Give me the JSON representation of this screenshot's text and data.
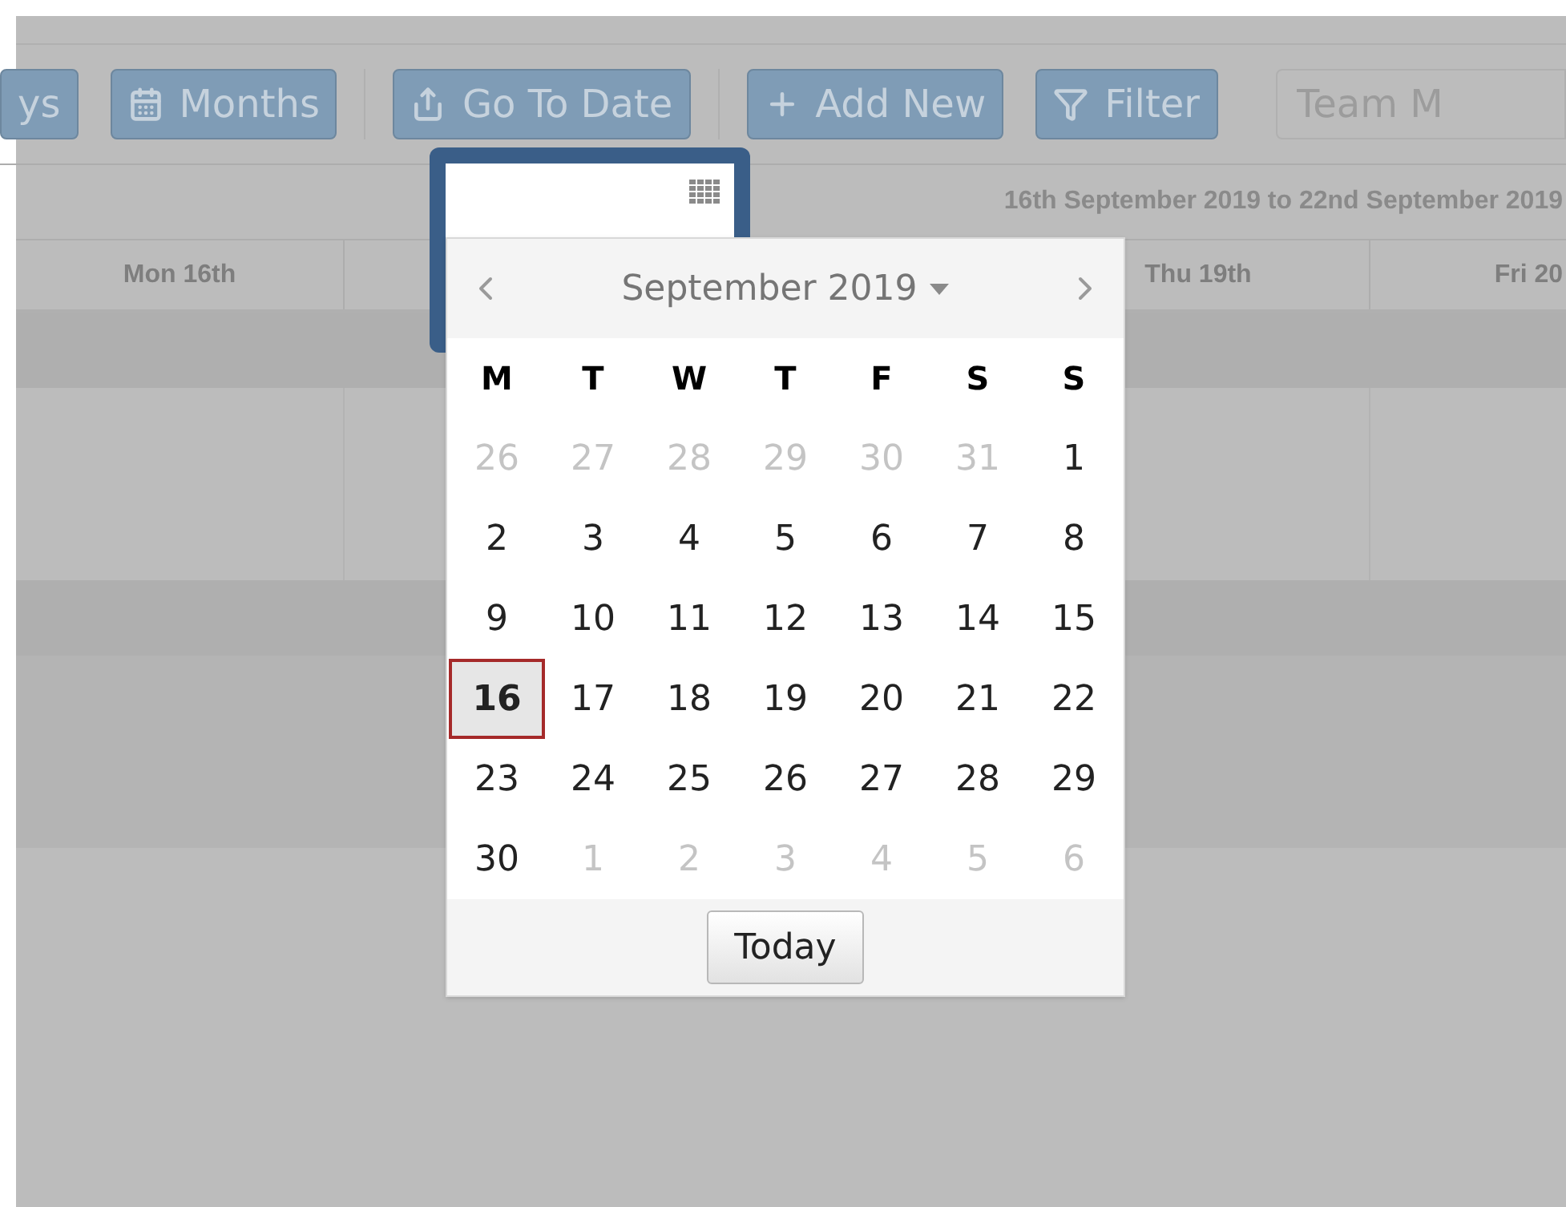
{
  "toolbar": {
    "groups": [
      [
        {
          "label": "ys"
        },
        {
          "label": "Months"
        }
      ],
      [
        {
          "label": "Go To Date"
        }
      ],
      [
        {
          "label": "Add New"
        },
        {
          "label": "Filter"
        }
      ]
    ],
    "team_field": {
      "placeholder": "Team M"
    }
  },
  "date_range": "16th September 2019 to 22nd September 2019",
  "day_columns": [
    "Mon 16th",
    "Thu 19th",
    "Fri 20"
  ],
  "date_picker": {
    "month_label": "September 2019",
    "weekdays": [
      "M",
      "T",
      "W",
      "T",
      "F",
      "S",
      "S"
    ],
    "weeks": [
      [
        {
          "day": "26",
          "outside": true,
          "selected": false
        },
        {
          "day": "27",
          "outside": true,
          "selected": false
        },
        {
          "day": "28",
          "outside": true,
          "selected": false
        },
        {
          "day": "29",
          "outside": true,
          "selected": false
        },
        {
          "day": "30",
          "outside": true,
          "selected": false
        },
        {
          "day": "31",
          "outside": true,
          "selected": false
        },
        {
          "day": "1",
          "outside": false,
          "selected": false
        }
      ],
      [
        {
          "day": "2",
          "outside": false,
          "selected": false
        },
        {
          "day": "3",
          "outside": false,
          "selected": false
        },
        {
          "day": "4",
          "outside": false,
          "selected": false
        },
        {
          "day": "5",
          "outside": false,
          "selected": false
        },
        {
          "day": "6",
          "outside": false,
          "selected": false
        },
        {
          "day": "7",
          "outside": false,
          "selected": false
        },
        {
          "day": "8",
          "outside": false,
          "selected": false
        }
      ],
      [
        {
          "day": "9",
          "outside": false,
          "selected": false
        },
        {
          "day": "10",
          "outside": false,
          "selected": false
        },
        {
          "day": "11",
          "outside": false,
          "selected": false
        },
        {
          "day": "12",
          "outside": false,
          "selected": false
        },
        {
          "day": "13",
          "outside": false,
          "selected": false
        },
        {
          "day": "14",
          "outside": false,
          "selected": false
        },
        {
          "day": "15",
          "outside": false,
          "selected": false
        }
      ],
      [
        {
          "day": "16",
          "outside": false,
          "selected": true
        },
        {
          "day": "17",
          "outside": false,
          "selected": false
        },
        {
          "day": "18",
          "outside": false,
          "selected": false
        },
        {
          "day": "19",
          "outside": false,
          "selected": false
        },
        {
          "day": "20",
          "outside": false,
          "selected": false
        },
        {
          "day": "21",
          "outside": false,
          "selected": false
        },
        {
          "day": "22",
          "outside": false,
          "selected": false
        }
      ],
      [
        {
          "day": "23",
          "outside": false,
          "selected": false
        },
        {
          "day": "24",
          "outside": false,
          "selected": false
        },
        {
          "day": "25",
          "outside": false,
          "selected": false
        },
        {
          "day": "26",
          "outside": false,
          "selected": false
        },
        {
          "day": "27",
          "outside": false,
          "selected": false
        },
        {
          "day": "28",
          "outside": false,
          "selected": false
        },
        {
          "day": "29",
          "outside": false,
          "selected": false
        }
      ],
      [
        {
          "day": "30",
          "outside": false,
          "selected": false
        },
        {
          "day": "1",
          "outside": true,
          "selected": false
        },
        {
          "day": "2",
          "outside": true,
          "selected": false
        },
        {
          "day": "3",
          "outside": true,
          "selected": false
        },
        {
          "day": "4",
          "outside": true,
          "selected": false
        },
        {
          "day": "5",
          "outside": true,
          "selected": false
        },
        {
          "day": "6",
          "outside": true,
          "selected": false
        }
      ]
    ],
    "today_button": "Today"
  }
}
